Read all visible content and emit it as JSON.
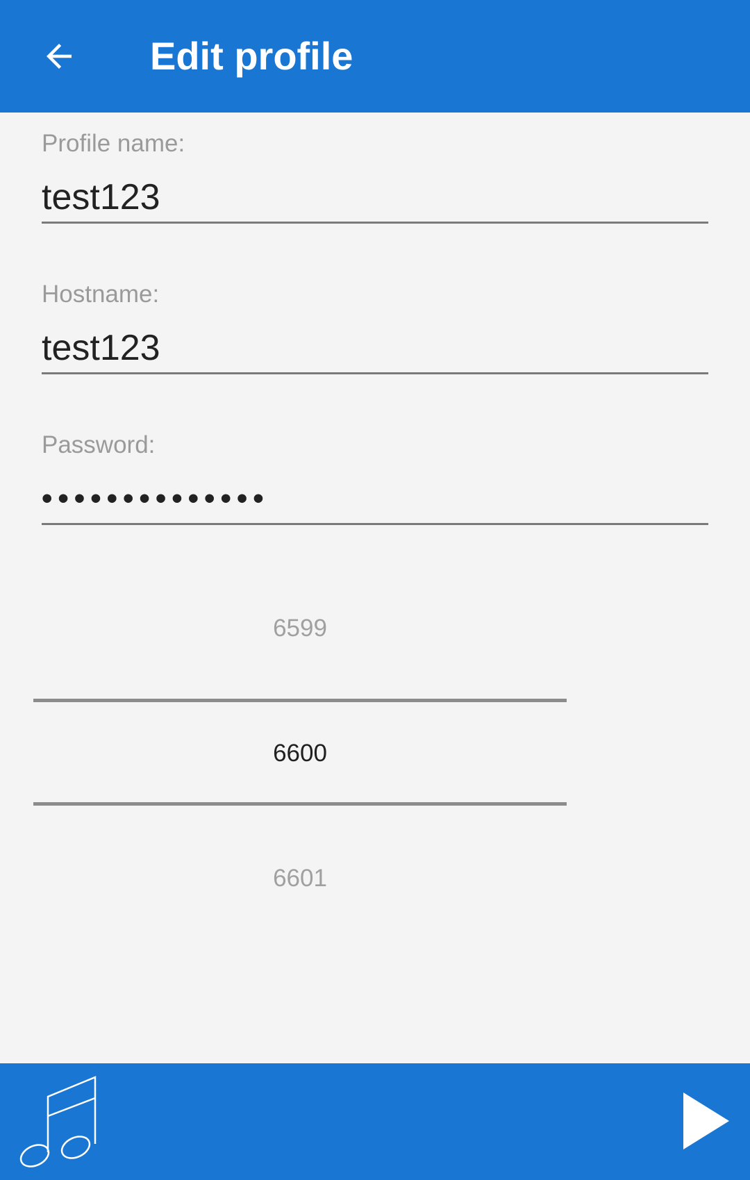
{
  "appbar": {
    "title": "Edit profile",
    "back_icon": "arrow-back-icon"
  },
  "form": {
    "profile_name": {
      "label": "Profile name:",
      "value": "test123"
    },
    "hostname": {
      "label": "Hostname:",
      "value": "test123"
    },
    "password": {
      "label": "Password:",
      "value": "••••••••••••••"
    }
  },
  "port_picker": {
    "previous": "6599",
    "selected": "6600",
    "next": "6601"
  },
  "bottombar": {
    "left_icon": "music-note-icon",
    "right_icon": "play-icon"
  },
  "colors": {
    "primary": "#1976d2",
    "background": "#f4f4f4",
    "label": "#9a9a9a",
    "text": "#222222"
  }
}
